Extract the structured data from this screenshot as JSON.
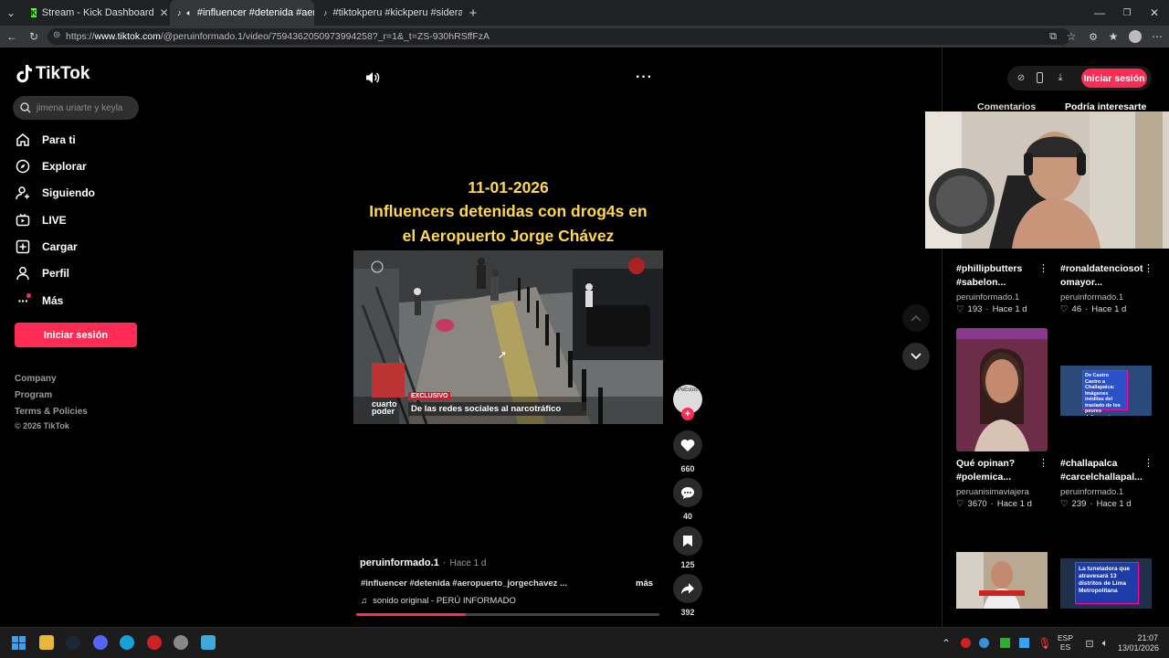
{
  "browser": {
    "tabs": [
      {
        "title": "Stream - Kick Dashboard",
        "icon": "kick-icon"
      },
      {
        "title": "#influencer #detenida #aerop",
        "icon": "tiktok-icon"
      },
      {
        "title": "#tiktokperu #kickperu #sideral #s",
        "icon": "tiktok-icon"
      }
    ],
    "url_prefix": "https://",
    "url_domain": "www.tiktok.com",
    "url_path": "/@peruinformado.1/video/7594362050973994258?_r=1&_t=ZS-930hRSffFzA"
  },
  "sidebar": {
    "logo": "TikTok",
    "search_placeholder": "jimena uriarte y keyla",
    "items": [
      {
        "label": "Para ti",
        "icon": "home-icon"
      },
      {
        "label": "Explorar",
        "icon": "compass-icon"
      },
      {
        "label": "Siguiendo",
        "icon": "following-icon"
      },
      {
        "label": "LIVE",
        "icon": "live-icon"
      },
      {
        "label": "Cargar",
        "icon": "upload-icon"
      },
      {
        "label": "Perfil",
        "icon": "profile-icon"
      },
      {
        "label": "Más",
        "icon": "more-icon"
      }
    ],
    "login": "Iniciar sesión",
    "footer": [
      "Company",
      "Program",
      "Terms & Policies",
      "© 2026 TikTok"
    ]
  },
  "video": {
    "date": "11-01-2026",
    "headline_1": "Influencers detenidas con drog4s en",
    "headline_2": "el Aeropuerto Jorge Chávez",
    "overlay_tag": "EXCLUSIVO",
    "overlay_caption": "De las redes sociales al narcotráfico",
    "overlay_brand_1": "cuarto",
    "overlay_brand_2": "poder",
    "author": "peruinformado.1",
    "time": "Hace 1 d",
    "description": "#influencer #detenida #aeropuerto_jorgechavez ...",
    "more": "más",
    "sound": "sonido original - PERÚ INFORMADO",
    "progress": 0.36,
    "avatar_text": "PeEstos"
  },
  "actions": {
    "likes": "660",
    "comments": "40",
    "saves": "125",
    "shares": "392"
  },
  "right_panel": {
    "login": "Iniciar sesión",
    "tabs": [
      "Comentarios",
      "Podría interesarte"
    ],
    "cards": [
      {
        "title": "#phillipbutters #sabelon...",
        "author": "peruinformado.1",
        "likes": "193",
        "time": "Hace 1 d"
      },
      {
        "title": "#ronaldatenciosot omayor...",
        "author": "peruinformado.1",
        "likes": "46",
        "time": "Hace 1 d"
      },
      {
        "title": "Qué opinan? #polemica...",
        "author": "peruanisimaviajera",
        "likes": "3670",
        "time": "Hace 1 d"
      },
      {
        "title": "#challapalca #carcelchallapal...",
        "author": "peruinformado.1",
        "likes": "239",
        "time": "Hace 1 d"
      }
    ],
    "thumb_text_1": "De Castro Castro a Challapalca: Imágenes inéditas del traslado de los peores delincuentes",
    "thumb_text_2": "La tuneladora que atravesará 13 distritos de Lima Metropolitana"
  },
  "taskbar": {
    "lang_1": "ESP",
    "lang_2": "ES",
    "time": "21:07",
    "date": "13/01/2026"
  },
  "colors": {
    "accent": "#fe2c55",
    "headline": "#ffd84d",
    "bg": "#000000"
  }
}
